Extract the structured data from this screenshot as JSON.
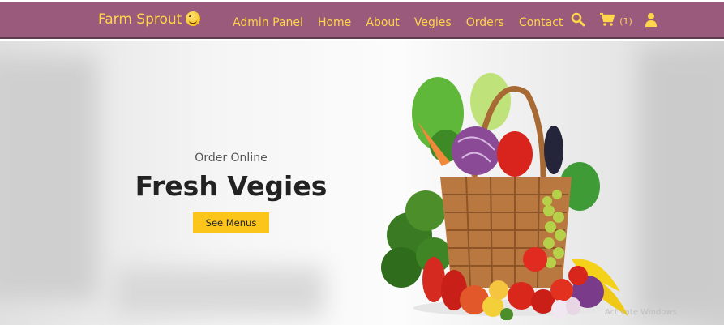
{
  "navbar": {
    "brand": "Farm Sprout",
    "links": [
      "Admin Panel",
      "Home",
      "About",
      "Vegies",
      "Orders",
      "Contact"
    ],
    "cart_count": "(1)",
    "icons": [
      "search-icon",
      "cart-icon",
      "user-icon"
    ]
  },
  "hero": {
    "tagline": "Order Online",
    "title": "Fresh Vegies",
    "cta_label": "See Menus",
    "watermark": "Activate Windows"
  },
  "colors": {
    "navbar_bg": "#9a5a7b",
    "accent": "#ffd54a",
    "button": "#fcc51a",
    "title": "#222222"
  }
}
